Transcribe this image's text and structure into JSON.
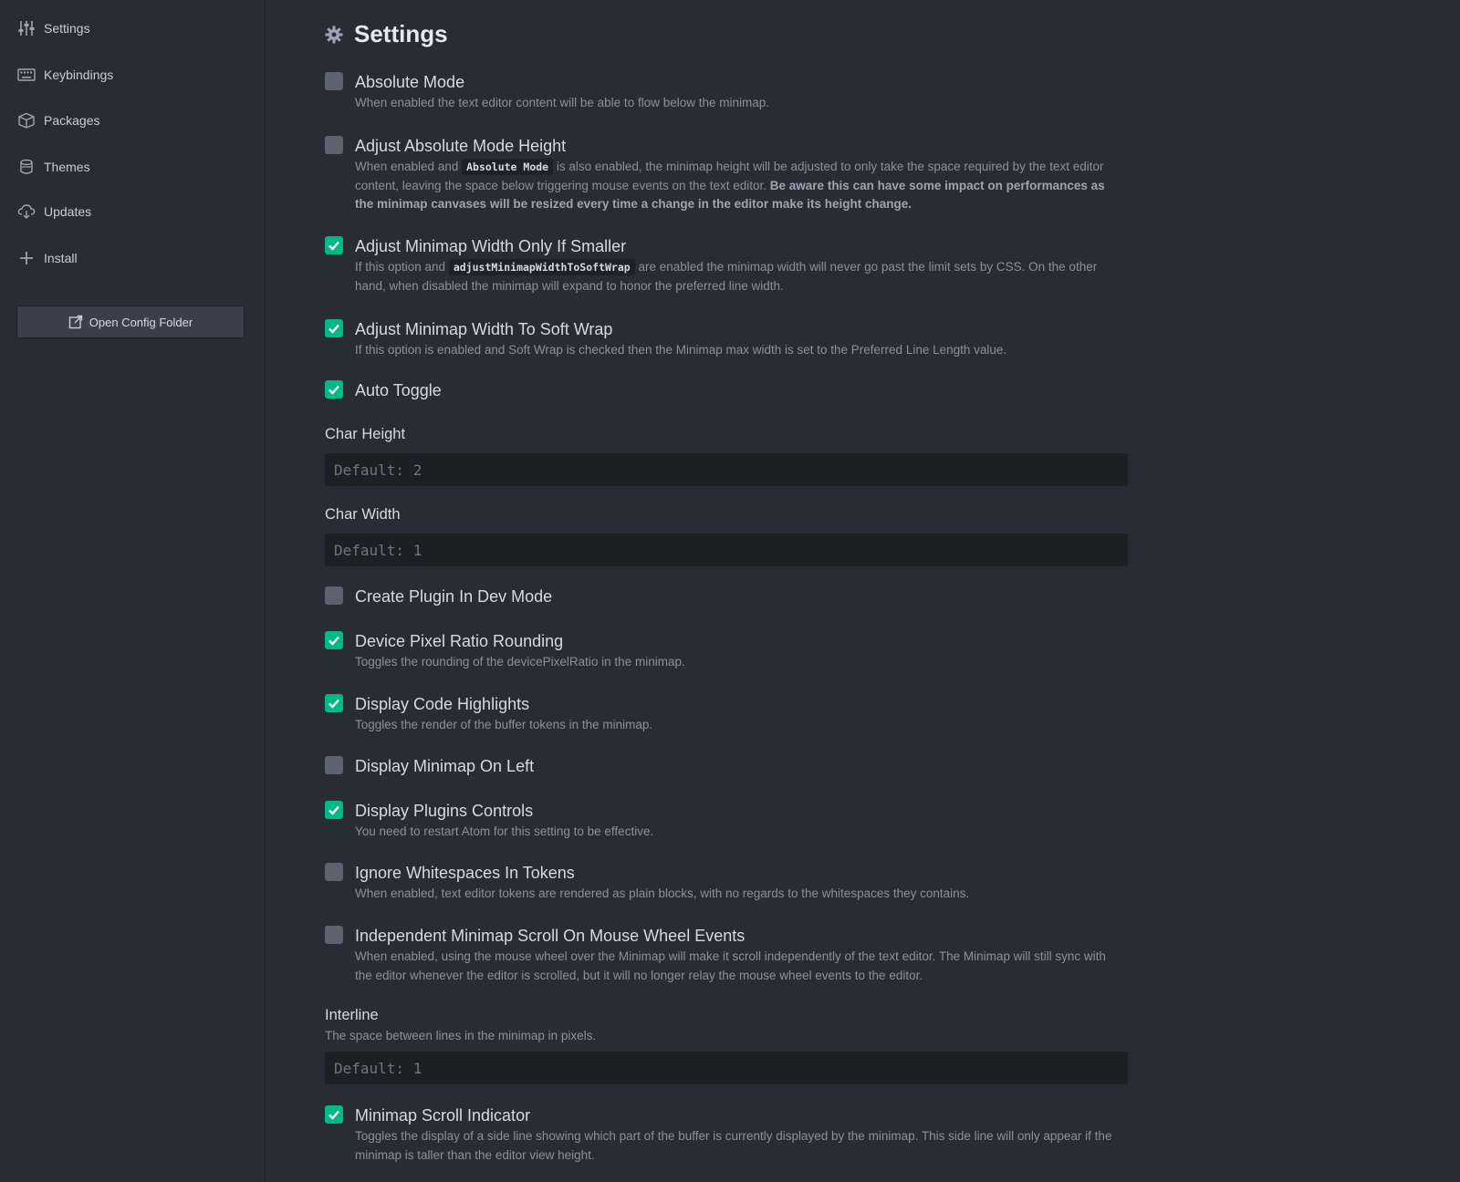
{
  "sidebar": {
    "items": [
      {
        "label": "Settings",
        "icon": "settings-sliders-icon"
      },
      {
        "label": "Keybindings",
        "icon": "keyboard-icon"
      },
      {
        "label": "Packages",
        "icon": "package-icon"
      },
      {
        "label": "Themes",
        "icon": "paintcan-icon"
      },
      {
        "label": "Updates",
        "icon": "cloud-download-icon"
      },
      {
        "label": "Install",
        "icon": "plus-icon"
      }
    ],
    "open_config_label": "Open Config Folder"
  },
  "page": {
    "title": "Settings"
  },
  "settings": [
    {
      "title": "Absolute Mode",
      "checked": false,
      "desc": "When enabled the text editor content will be able to flow below the minimap."
    },
    {
      "title": "Adjust Absolute Mode Height",
      "checked": false,
      "desc_pre": "When enabled and ",
      "desc_code": "Absolute Mode",
      "desc_post": " is also enabled, the minimap height will be adjusted to only take the space required by the text editor content, leaving the space below triggering mouse events on the text editor. ",
      "desc_bold": "Be aware this can have some impact on performances as the minimap canvases will be resized every time a change in the editor make its height change."
    },
    {
      "title": "Adjust Minimap Width Only If Smaller",
      "checked": true,
      "desc_pre": "If this option and ",
      "desc_code": "adjustMinimapWidthToSoftWrap",
      "desc_post": " are enabled the minimap width will never go past the limit sets by CSS. On the other hand, when disabled the minimap will expand to honor the preferred line width."
    },
    {
      "title": "Adjust Minimap Width To Soft Wrap",
      "checked": true,
      "desc": "If this option is enabled and Soft Wrap is checked then the Minimap max width is set to the Preferred Line Length value."
    },
    {
      "title": "Auto Toggle",
      "checked": true
    },
    {
      "title": "Create Plugin In Dev Mode",
      "checked": false
    },
    {
      "title": "Device Pixel Ratio Rounding",
      "checked": true,
      "desc": "Toggles the rounding of the devicePixelRatio in the minimap."
    },
    {
      "title": "Display Code Highlights",
      "checked": true,
      "desc": "Toggles the render of the buffer tokens in the minimap."
    },
    {
      "title": "Display Minimap On Left",
      "checked": false
    },
    {
      "title": "Display Plugins Controls",
      "checked": true,
      "desc": "You need to restart Atom for this setting to be effective."
    },
    {
      "title": "Ignore Whitespaces In Tokens",
      "checked": false,
      "desc": "When enabled, text editor tokens are rendered as plain blocks, with no regards to the whitespaces they contains."
    },
    {
      "title": "Independent Minimap Scroll On Mouse Wheel Events",
      "checked": false,
      "desc": "When enabled, using the mouse wheel over the Minimap will make it scroll independently of the text editor. The Minimap will still sync with the editor whenever the editor is scrolled, but it will no longer relay the mouse wheel events to the editor."
    },
    {
      "title": "Minimap Scroll Indicator",
      "checked": true,
      "desc": "Toggles the display of a side line showing which part of the buffer is currently displayed by the minimap. This side line will only appear if the minimap is taller than the editor view height."
    }
  ],
  "fields": {
    "char_height": {
      "label": "Char Height",
      "placeholder": "Default: 2"
    },
    "char_width": {
      "label": "Char Width",
      "placeholder": "Default: 1"
    },
    "interline": {
      "label": "Interline",
      "desc": "The space between lines in the minimap in pixels.",
      "placeholder": "Default: 1"
    }
  },
  "colors": {
    "accent": "#00b88a",
    "background": "#282c34",
    "input_bg": "#1d1f23"
  }
}
